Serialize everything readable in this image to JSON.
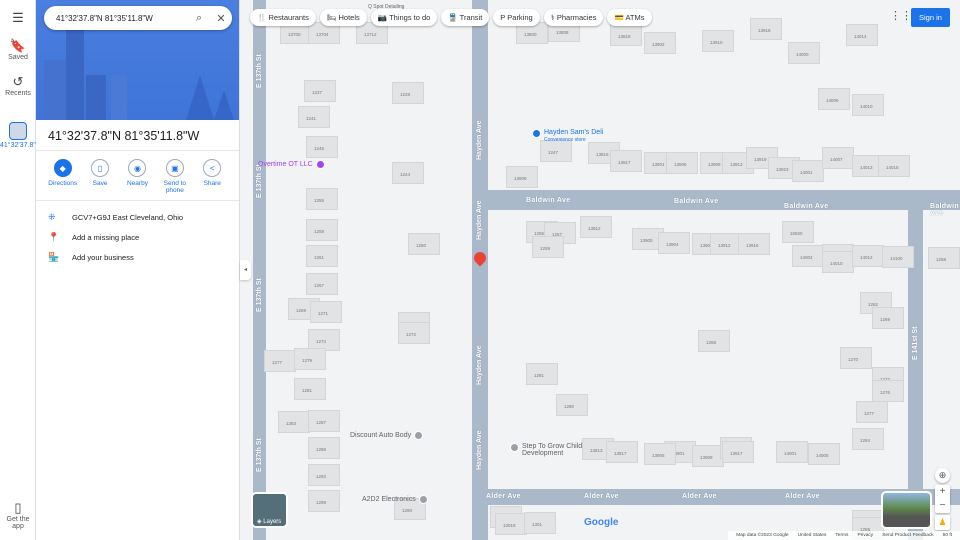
{
  "rail": {
    "saved": "Saved",
    "recents": "Recents",
    "recent_place": "41°32'37.8\"N...",
    "get_app": "Get the app"
  },
  "search": {
    "value": "41°32'37.8\"N 81°35'11.8\"W"
  },
  "place": {
    "title": "41°32'37.8\"N 81°35'11.8\"W",
    "actions": [
      {
        "label": "Directions",
        "icon": "directions-icon"
      },
      {
        "label": "Save",
        "icon": "bookmark-icon"
      },
      {
        "label": "Nearby",
        "icon": "nearby-icon"
      },
      {
        "label": "Send to phone",
        "icon": "send-to-phone-icon"
      },
      {
        "label": "Share",
        "icon": "share-icon"
      }
    ],
    "plus_code": "GCV7+G9J East Cleveland, Ohio",
    "add_place": "Add a missing place",
    "add_business": "Add your business"
  },
  "chips": [
    {
      "label": "Restaurants",
      "icon": "🍴"
    },
    {
      "label": "Hotels",
      "icon": "🛏"
    },
    {
      "label": "Things to do",
      "icon": "📷"
    },
    {
      "label": "Transit",
      "icon": "🚆"
    },
    {
      "label": "Parking",
      "icon": "P"
    },
    {
      "label": "Pharmacies",
      "icon": "⚕"
    },
    {
      "label": "ATMs",
      "icon": "💳"
    }
  ],
  "header": {
    "sign_in": "Sign in"
  },
  "roads": {
    "e137": "E 137th St",
    "hayden": "Hayden Ave",
    "baldwin": "Baldwin Ave",
    "alder": "Alder Ave",
    "e141": "E 141st St"
  },
  "pois": {
    "overtime": "Overtime OT LLC",
    "deli": "Hayden Sam's Deli",
    "deli_sub": "Convenience store",
    "discount": "Discount Auto Body",
    "a2d2": "A2D2 Electronics",
    "step": "Step To Grow Child Development",
    "detailing": "Q Spot Detailing"
  },
  "addresses": [
    "13700",
    "13704",
    "13712",
    "1237",
    "1228",
    "1241",
    "1245",
    "1244",
    "1255",
    "1259",
    "1250",
    "1261",
    "1267",
    "1269",
    "1271",
    "1270",
    "1272",
    "1273",
    "1277",
    "1279",
    "1281",
    "1283",
    "1287",
    "1289",
    "1293",
    "1299",
    "1290",
    "13800",
    "13808",
    "13818",
    "13902",
    "13910",
    "13918",
    "14000",
    "14014",
    "14006",
    "14010",
    "1247",
    "13809",
    "13815",
    "13817",
    "13901",
    "13905",
    "13909",
    "13913",
    "13919",
    "13923",
    "14001",
    "14007",
    "14013",
    "14015",
    "1255",
    "1257",
    "1259",
    "13812",
    "13900",
    "13904",
    "13908",
    "13912",
    "13916",
    "15920",
    "14004",
    "14006",
    "14010",
    "14012",
    "14100",
    "1258",
    "1262",
    "1269",
    "1268",
    "1270",
    "1272",
    "1276",
    "1277",
    "1281",
    "1280",
    "1284",
    "13813",
    "13817",
    "13901",
    "13905",
    "13909",
    "13913",
    "13917",
    "14001",
    "14005",
    "1288",
    "1286",
    "1299",
    "13018",
    "1301"
  ],
  "layers": "Layers",
  "footer": {
    "map_data": "Map data ©2023 Google",
    "region": "United States",
    "terms": "Terms",
    "privacy": "Privacy",
    "feedback": "Send Product Feedback",
    "scale": "50 ft"
  },
  "logo": "Google"
}
